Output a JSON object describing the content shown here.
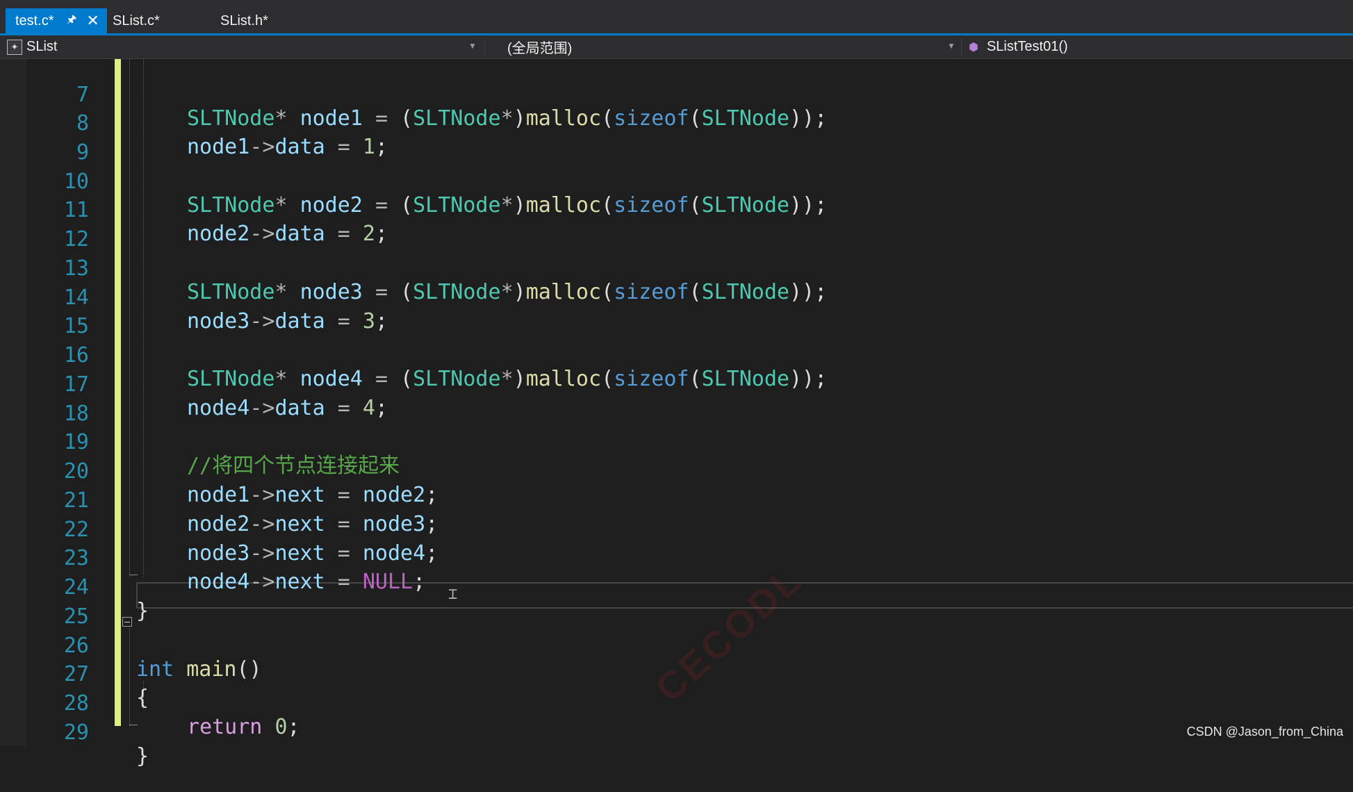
{
  "tabs": [
    {
      "label": "test.c*",
      "active": true,
      "pinned": true,
      "closable": true
    },
    {
      "label": "SList.c*",
      "active": false
    },
    {
      "label": "SList.h*",
      "active": false
    }
  ],
  "navbar": {
    "project": "SList",
    "scope": "(全局范围)",
    "member": "SListTest01()"
  },
  "editor": {
    "lines": [
      {
        "n": "7",
        "text": "SLTNode* node1 = (SLTNode*)malloc(sizeof(SLTNode));"
      },
      {
        "n": "8",
        "text": "node1->data = 1;"
      },
      {
        "n": "9",
        "text": ""
      },
      {
        "n": "10",
        "text": "SLTNode* node2 = (SLTNode*)malloc(sizeof(SLTNode));"
      },
      {
        "n": "11",
        "text": "node2->data = 2;"
      },
      {
        "n": "12",
        "text": ""
      },
      {
        "n": "13",
        "text": "SLTNode* node3 = (SLTNode*)malloc(sizeof(SLTNode));"
      },
      {
        "n": "14",
        "text": "node3->data = 3;"
      },
      {
        "n": "15",
        "text": ""
      },
      {
        "n": "16",
        "text": "SLTNode* node4 = (SLTNode*)malloc(sizeof(SLTNode));"
      },
      {
        "n": "17",
        "text": "node4->data = 4;"
      },
      {
        "n": "18",
        "text": ""
      },
      {
        "n": "19",
        "text": "//将四个节点连接起来"
      },
      {
        "n": "20",
        "text": "node1->next = node2;"
      },
      {
        "n": "21",
        "text": "node2->next = node3;"
      },
      {
        "n": "22",
        "text": "node3->next = node4;"
      },
      {
        "n": "23",
        "text": "node4->next = NULL;"
      },
      {
        "n": "24",
        "text": "}"
      },
      {
        "n": "25",
        "text": ""
      },
      {
        "n": "26",
        "text": "int main()"
      },
      {
        "n": "27",
        "text": "{"
      },
      {
        "n": "28",
        "text": "return 0;"
      },
      {
        "n": "29",
        "text": "}"
      }
    ]
  },
  "watermark": "CECODL",
  "credit": "CSDN @Jason_from_China",
  "colors": {
    "accent": "#007acc",
    "type": "#4ec9b0",
    "variable": "#9cdcfe",
    "function": "#dcdcaa",
    "keyword": "#569cd6",
    "control": "#d8a0df",
    "number": "#b5cea8",
    "comment": "#57a64a",
    "macro": "#bd63c5",
    "line_number": "#2b91af",
    "change_bar": "#e0f07a"
  }
}
